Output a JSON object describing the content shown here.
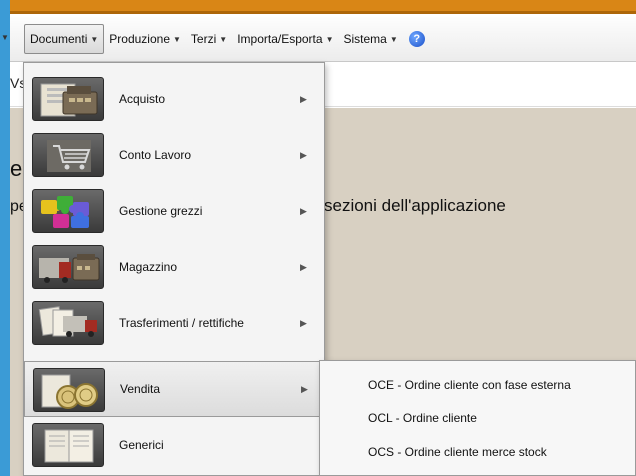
{
  "menubar": {
    "items": [
      {
        "label": "Documenti",
        "active": true
      },
      {
        "label": "Produzione"
      },
      {
        "label": "Terzi"
      },
      {
        "label": "Importa/Esporta"
      },
      {
        "label": "Sistema"
      }
    ],
    "help_icon": "question-circle-icon",
    "help_glyph": "?"
  },
  "background": {
    "search_fragment": "Vs",
    "title_fragment": "e",
    "line_fragment": "pe",
    "description": "sezioni dell'applicazione"
  },
  "documenti_menu": {
    "items": [
      {
        "label": "Acquisto",
        "icon": "cash-register-icon",
        "has_submenu": true
      },
      {
        "label": "Conto Lavoro",
        "icon": "shopping-cart-icon",
        "has_submenu": true
      },
      {
        "label": "Gestione grezzi",
        "icon": "puzzle-pieces-icon",
        "has_submenu": true
      },
      {
        "label": "Magazzino",
        "icon": "truck-register-icon",
        "has_submenu": true
      },
      {
        "label": "Trasferimenti / rettifiche",
        "icon": "truck-documents-icon",
        "has_submenu": true
      },
      {
        "label": "Vendita",
        "icon": "coins-icon",
        "has_submenu": true,
        "highlighted": true
      },
      {
        "label": "Generici",
        "icon": "documents-icon",
        "has_submenu": false
      }
    ]
  },
  "vendita_submenu": {
    "items": [
      {
        "label": "OCE - Ordine cliente con fase esterna"
      },
      {
        "label": "OCL - Ordine cliente"
      },
      {
        "label": "OCS - Ordine cliente merce stock"
      }
    ]
  },
  "colors": {
    "accent_top": "#d98616",
    "frame_blue": "#3b9bd6",
    "content_bg": "#d8d0c2",
    "menu_bg": "#f4f4f4"
  }
}
